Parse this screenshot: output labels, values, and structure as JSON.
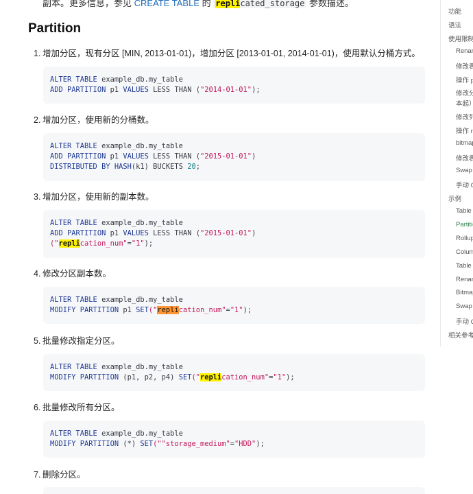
{
  "intro": {
    "prefix": "副本。更多信息，参见",
    "link": "CREATE TABLE",
    "middle": "的",
    "code_hl": "repli",
    "code_rest": "cated_storage",
    "suffix": "参数描述。"
  },
  "section_title": "Partition",
  "steps": [
    {
      "num": "1.",
      "text": "增加分区，现有分区 [MIN, 2013-01-01)，增加分区 [2013-01-01, 2014-01-01)，使用默认分桶方式。"
    },
    {
      "num": "2.",
      "text": "增加分区，使用新的分桶数。"
    },
    {
      "num": "3.",
      "text": "增加分区，使用新的副本数。"
    },
    {
      "num": "4.",
      "text": "修改分区副本数。"
    },
    {
      "num": "5.",
      "text": "批量修改指定分区。"
    },
    {
      "num": "6.",
      "text": "批量修改所有分区。"
    },
    {
      "num": "7.",
      "text": "删除分区。"
    }
  ],
  "code": {
    "alter": "ALTER TABLE",
    "table": " example_db.my_table",
    "add_partition": "ADD PARTITION",
    "modify_partition": "MODIFY PARTITION",
    "p1": " p1 ",
    "values": "VALUES",
    "less_than": " LESS THAN (",
    "close": ")",
    "close_semi": ");",
    "d2014": "\"2014-01-01\"",
    "d2015": "\"2015-01-01\"",
    "distributed_by": "DISTRIBUTED BY",
    "hash": " HASH",
    "k1": "(k1) BUCKETS ",
    "buckets": "20",
    "semi": ";",
    "open_q": "(\"",
    "hl": "repli",
    "replication_rest": "cation_num\"",
    "eq": "=",
    "one": "\"1\"",
    "set": "SET",
    "set_open": "(\"",
    "plist": " (p1, p2, p4) ",
    "pall": " (*) ",
    "storage_medium": "\"storage_medium\"",
    "hdd": "\"HDD\""
  },
  "toc": {
    "items": [
      {
        "label": "功能",
        "level": 1
      },
      {
        "label": "语法",
        "level": 1
      },
      {
        "label": "使用限制",
        "level": 1
      },
      {
        "label": "Renam",
        "level": 2
      },
      {
        "label": "修改表",
        "level": 2
      },
      {
        "label": "操作 p",
        "level": 2
      },
      {
        "label": "修改分",
        "level": 2
      },
      {
        "label": "本起）",
        "level": 2
      },
      {
        "label": "修改列",
        "level": 2
      },
      {
        "label": "操作 ro",
        "level": 2
      },
      {
        "label": "bitmap",
        "level": 2
      },
      {
        "label": "修改表",
        "level": 2
      },
      {
        "label": "Swap",
        "level": 2
      },
      {
        "label": "手动 C",
        "level": 2
      },
      {
        "label": "示例",
        "level": 1
      },
      {
        "label": "Table",
        "level": 2
      },
      {
        "label": "Partitio",
        "level": 2,
        "active": true
      },
      {
        "label": "Rollup",
        "level": 2
      },
      {
        "label": "Colum",
        "level": 2
      },
      {
        "label": "Table p",
        "level": 2
      },
      {
        "label": "Renam",
        "level": 2
      },
      {
        "label": "Bitmap",
        "level": 2
      },
      {
        "label": "Swap",
        "level": 2
      },
      {
        "label": "手动 C",
        "level": 2
      },
      {
        "label": "相关参考",
        "level": 1
      }
    ],
    "active_color": "#2f7d4e"
  },
  "colors": {
    "keyword": "#1f3a93",
    "string": "#c2185b",
    "number": "#0e7c86",
    "search_highlight": "#fff200",
    "search_active": "#ff9632",
    "code_bg": "#f6f7f9"
  }
}
